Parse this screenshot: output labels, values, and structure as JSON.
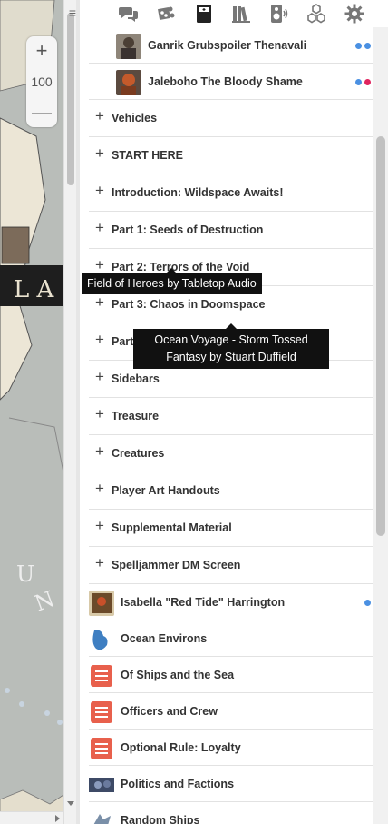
{
  "map": {
    "zoom_in": "+",
    "zoom_level": "100",
    "zoom_out": "—"
  },
  "tabs": [
    {
      "icon": "chat-icon"
    },
    {
      "icon": "dice-icon"
    },
    {
      "icon": "journal-icon"
    },
    {
      "icon": "compendium-icon"
    },
    {
      "icon": "jukebox-icon"
    },
    {
      "icon": "collections-icon"
    },
    {
      "icon": "settings-icon"
    }
  ],
  "journal": {
    "nested_characters": [
      {
        "name": "Ganrik Grubspoiler Thenavali",
        "dots": [
          "#4a90e2",
          "#4a90e2"
        ]
      },
      {
        "name": "Jaleboho The Bloody Shame",
        "dots": [
          "#4a90e2",
          "#e0245e"
        ]
      }
    ],
    "folders": [
      "Vehicles",
      "START HERE",
      "Introduction: Wildspace Awaits!",
      "Part 1: Seeds of Destruction",
      "Part 2: Terrors of the Void",
      "Part 3: Chaos in Doomspace",
      "Part 4",
      "Sidebars",
      "Treasure",
      "Creatures",
      "Player Art Handouts",
      "Supplemental Material",
      "Spelljammer DM Screen"
    ],
    "items": [
      {
        "name": "Isabella \"Red Tide\" Harrington",
        "type": "character",
        "dots": [
          "#4a90e2"
        ]
      },
      {
        "name": "Ocean Environs",
        "type": "character",
        "dots": []
      },
      {
        "name": "Of Ships and the Sea",
        "type": "handout",
        "dots": []
      },
      {
        "name": "Officers and Crew",
        "type": "handout",
        "dots": []
      },
      {
        "name": "Optional Rule: Loyalty",
        "type": "handout",
        "dots": []
      },
      {
        "name": "Politics and Factions",
        "type": "character",
        "dots": []
      },
      {
        "name": "Random Ships",
        "type": "character",
        "dots": []
      }
    ]
  },
  "tooltips": {
    "field_of_heroes": "Field of Heroes by Tabletop Audio",
    "ocean_voyage_line1": "Ocean Voyage - Storm Tossed",
    "ocean_voyage_line2": "Fantasy by Stuart Duffield"
  },
  "colors": {
    "dot_blue": "#4a90e2",
    "dot_pink": "#e0245e",
    "handout_icon": "#e8604c",
    "tab_icon": "#777777",
    "tab_active": "#222222"
  }
}
